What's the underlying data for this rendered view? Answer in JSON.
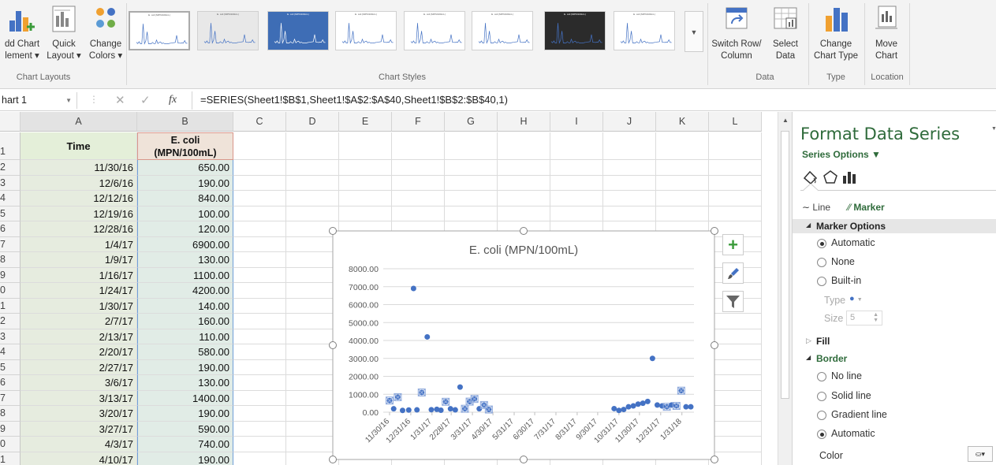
{
  "ribbon": {
    "add_chart_element": [
      "dd Chart",
      "lement ▾"
    ],
    "quick_layout": [
      "Quick",
      "Layout ▾"
    ],
    "change_colors": [
      "Change",
      "Colors ▾"
    ],
    "group_chart_layouts": "Chart Layouts",
    "group_chart_styles": "Chart Styles",
    "switch_row_column": [
      "Switch Row/",
      "Column"
    ],
    "select_data": [
      "Select",
      "Data"
    ],
    "group_data": "Data",
    "change_chart_type": [
      "Change",
      "Chart Type"
    ],
    "group_type": "Type",
    "move_chart": [
      "Move",
      "Chart"
    ],
    "group_location": "Location",
    "style_thumb_title": "E. coli (MPN/100mL)"
  },
  "formula_bar": {
    "name_box": "hart 1",
    "fx": "fx",
    "formula": "=SERIES(Sheet1!$B$1,Sheet1!$A$2:$A$40,Sheet1!$B$2:$B$40,1)"
  },
  "columns": [
    "A",
    "B",
    "C",
    "D",
    "E",
    "F",
    "G",
    "H",
    "I",
    "J",
    "K",
    "L"
  ],
  "header_row": {
    "num": "1",
    "a": "Time",
    "b": "E. coli\n(MPN/100mL)"
  },
  "rows": [
    {
      "num": "2",
      "a": "11/30/16",
      "b": "650.00"
    },
    {
      "num": "3",
      "a": "12/6/16",
      "b": "190.00"
    },
    {
      "num": "4",
      "a": "12/12/16",
      "b": "840.00"
    },
    {
      "num": "5",
      "a": "12/19/16",
      "b": "100.00"
    },
    {
      "num": "6",
      "a": "12/28/16",
      "b": "120.00"
    },
    {
      "num": "7",
      "a": "1/4/17",
      "b": "6900.00"
    },
    {
      "num": "8",
      "a": "1/9/17",
      "b": "130.00"
    },
    {
      "num": "9",
      "a": "1/16/17",
      "b": "1100.00"
    },
    {
      "num": "0",
      "a": "1/24/17",
      "b": "4200.00"
    },
    {
      "num": "1",
      "a": "1/30/17",
      "b": "140.00"
    },
    {
      "num": "2",
      "a": "2/7/17",
      "b": "160.00"
    },
    {
      "num": "3",
      "a": "2/13/17",
      "b": "110.00"
    },
    {
      "num": "4",
      "a": "2/20/17",
      "b": "580.00"
    },
    {
      "num": "5",
      "a": "2/27/17",
      "b": "190.00"
    },
    {
      "num": "6",
      "a": "3/6/17",
      "b": "130.00"
    },
    {
      "num": "7",
      "a": "3/13/17",
      "b": "1400.00"
    },
    {
      "num": "8",
      "a": "3/20/17",
      "b": "190.00"
    },
    {
      "num": "9",
      "a": "3/27/17",
      "b": "590.00"
    },
    {
      "num": "0",
      "a": "4/3/17",
      "b": "740.00"
    },
    {
      "num": "1",
      "a": "4/10/17",
      "b": "190.00"
    }
  ],
  "chart_data": {
    "type": "scatter",
    "title": "E. coli (MPN/100mL)",
    "xlabel": "",
    "ylabel": "",
    "ylim": [
      0,
      8000
    ],
    "y_ticks": [
      "0.00",
      "1000.00",
      "2000.00",
      "3000.00",
      "4000.00",
      "5000.00",
      "6000.00",
      "7000.00",
      "8000.00"
    ],
    "x_ticks": [
      "11/30/16",
      "12/31/16",
      "1/31/17",
      "2/28/17",
      "3/31/17",
      "4/30/17",
      "5/31/17",
      "6/30/17",
      "7/31/17",
      "8/31/17",
      "9/30/17",
      "10/31/17",
      "11/30/17",
      "12/31/17",
      "1/31/18"
    ],
    "grid": true,
    "marker_color": "#4472c4",
    "x": [
      "11/30/16",
      "12/6/16",
      "12/12/16",
      "12/19/16",
      "12/28/16",
      "1/4/17",
      "1/9/17",
      "1/16/17",
      "1/24/17",
      "1/30/17",
      "2/7/17",
      "2/13/17",
      "2/20/17",
      "2/27/17",
      "3/6/17",
      "3/13/17",
      "3/20/17",
      "3/27/17",
      "4/3/17",
      "4/10/17",
      "4/17/17",
      "4/24/17",
      "10/24/17",
      "10/31/17",
      "11/7/17",
      "11/14/17",
      "11/21/17",
      "11/28/17",
      "12/5/17",
      "12/12/17",
      "12/19/17",
      "12/26/17",
      "1/2/18",
      "1/9/18",
      "1/16/18",
      "1/23/18",
      "1/30/18",
      "2/6/18",
      "2/13/18"
    ],
    "day_offsets": [
      0,
      6,
      12,
      19,
      28,
      35,
      40,
      47,
      55,
      61,
      69,
      75,
      82,
      89,
      96,
      103,
      110,
      117,
      124,
      131,
      138,
      145,
      328,
      335,
      342,
      349,
      356,
      363,
      370,
      377,
      384,
      391,
      398,
      405,
      412,
      419,
      426,
      433,
      440
    ],
    "values": [
      650,
      190,
      840,
      100,
      120,
      6900,
      130,
      1100,
      4200,
      140,
      160,
      110,
      580,
      190,
      130,
      1400,
      190,
      590,
      740,
      190,
      400,
      150,
      200,
      100,
      150,
      300,
      350,
      450,
      500,
      600,
      3000,
      400,
      350,
      300,
      400,
      350,
      1200,
      300,
      300
    ],
    "selected": [
      0,
      2,
      7,
      12,
      16,
      17,
      18,
      20,
      21,
      33,
      35,
      36
    ]
  },
  "chart_side_buttons": [
    "chart-elements-plus",
    "chart-styles-brush",
    "chart-filters-funnel"
  ],
  "pane": {
    "title": "Format Data Series",
    "series_options": "Series Options ▼",
    "tab_line": "Line",
    "tab_marker": "Marker",
    "marker_options": "Marker Options",
    "automatic": "Automatic",
    "none": "None",
    "builtin": "Built-in",
    "type_label": "Type",
    "size_label": "Size",
    "size_value": "5",
    "fill": "Fill",
    "border": "Border",
    "no_line": "No line",
    "solid_line": "Solid line",
    "gradient_line": "Gradient line",
    "border_automatic": "Automatic",
    "color": "Color"
  }
}
